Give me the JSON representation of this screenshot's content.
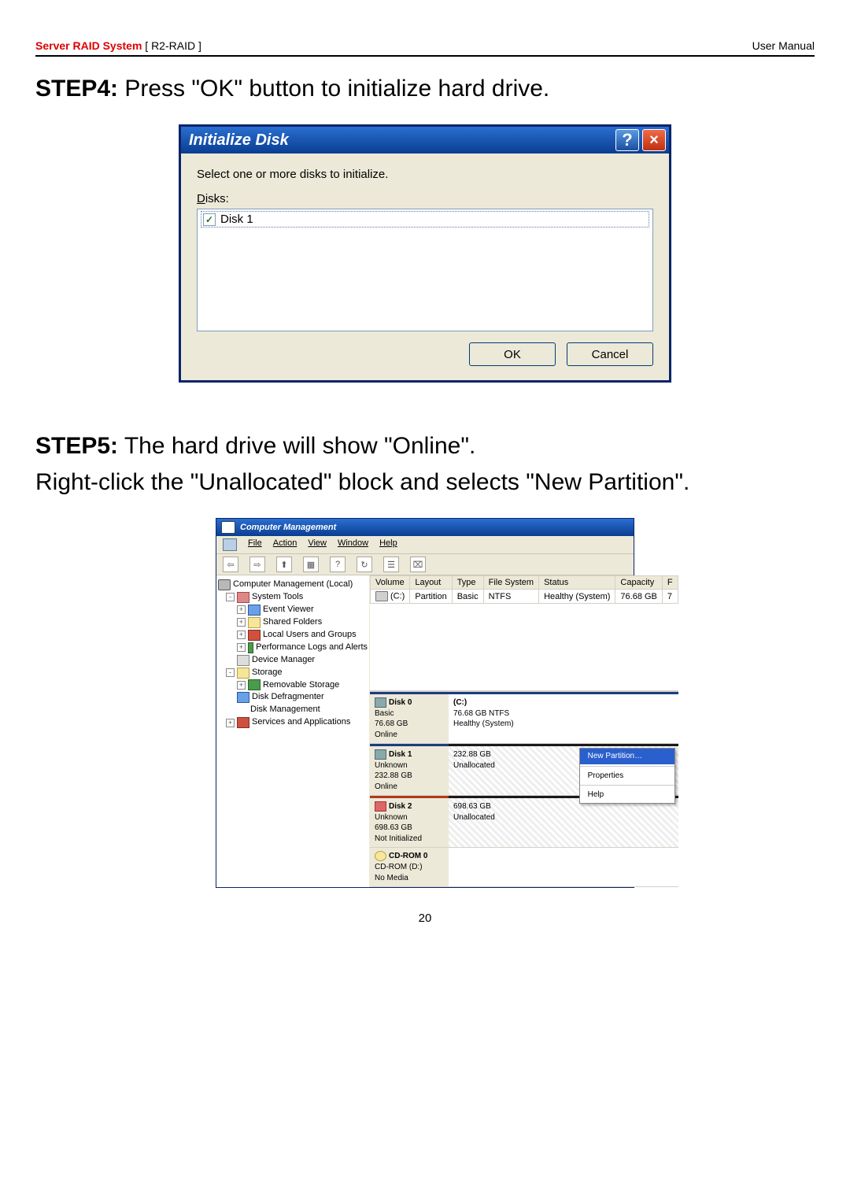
{
  "header": {
    "left_red": "Server RAID System",
    "left_black": " [ R2-RAID ]",
    "right": "User Manual"
  },
  "step4": {
    "label": "STEP4:",
    "text": " Press \"OK\" button to initialize hard drive."
  },
  "dlg_init": {
    "title": "Initialize Disk",
    "help_char": "?",
    "close_char": "×",
    "instruction": "Select one or more disks to initialize.",
    "disks_label_u": "D",
    "disks_label_rest": "isks:",
    "disk_checked": "✓",
    "disk1": "Disk 1",
    "ok": "OK",
    "cancel": "Cancel"
  },
  "step5": {
    "label": "STEP5:",
    "line1_rest": " The hard drive will show \"Online\".",
    "line2": "Right-click the \"Unallocated\" block and selects \"New Partition\"."
  },
  "cm": {
    "title": "Computer Management",
    "menu": {
      "file": "File",
      "action": "Action",
      "view": "View",
      "window": "Window",
      "help": "Help"
    },
    "toolbar_icons": [
      "⇦",
      "⇨",
      "⬆",
      "▦",
      "?",
      "↻",
      "☰",
      "⌧"
    ],
    "tree": {
      "root": "Computer Management (Local)",
      "system_tools": "System Tools",
      "event_viewer": "Event Viewer",
      "shared_folders": "Shared Folders",
      "local_users": "Local Users and Groups",
      "perf": "Performance Logs and Alerts",
      "dev_mgr": "Device Manager",
      "storage": "Storage",
      "rem_storage": "Removable Storage",
      "defrag": "Disk Defragmenter",
      "disk_mgmt": "Disk Management",
      "services": "Services and Applications"
    },
    "vol_header": {
      "volume": "Volume",
      "layout": "Layout",
      "type": "Type",
      "fs": "File System",
      "status": "Status",
      "capacity": "Capacity",
      "ftail": "F"
    },
    "vol_row": {
      "volume": "(C:)",
      "layout": "Partition",
      "type": "Basic",
      "fs": "NTFS",
      "status": "Healthy (System)",
      "capacity": "76.68 GB",
      "ftail": "7"
    },
    "disks": [
      {
        "name": "Disk 0",
        "l1": "Basic",
        "l2": "76.68 GB",
        "l3": "Online",
        "body_l1": "(C:)",
        "body_l2": "76.68 GB NTFS",
        "body_l3": "Healthy (System)",
        "body_kind": "healthy"
      },
      {
        "name": "Disk 1",
        "l1": "Unknown",
        "l2": "232.88 GB",
        "l3": "Online",
        "body_l1": "",
        "body_l2": "232.88 GB",
        "body_l3": "Unallocated",
        "body_kind": "unalloc"
      },
      {
        "name": "Disk 2",
        "l1": "Unknown",
        "l2": "698.63 GB",
        "l3": "Not Initialized",
        "body_l1": "",
        "body_l2": "698.63 GB",
        "body_l3": "Unallocated",
        "body_kind": "unalloc"
      }
    ],
    "cdrom": {
      "name": "CD-ROM 0",
      "l1": "CD-ROM (D:)",
      "l2": "",
      "l3": "No Media"
    },
    "ctx": {
      "new_partition": "New Partition…",
      "properties": "Properties",
      "help": "Help"
    }
  },
  "page_no": "20"
}
